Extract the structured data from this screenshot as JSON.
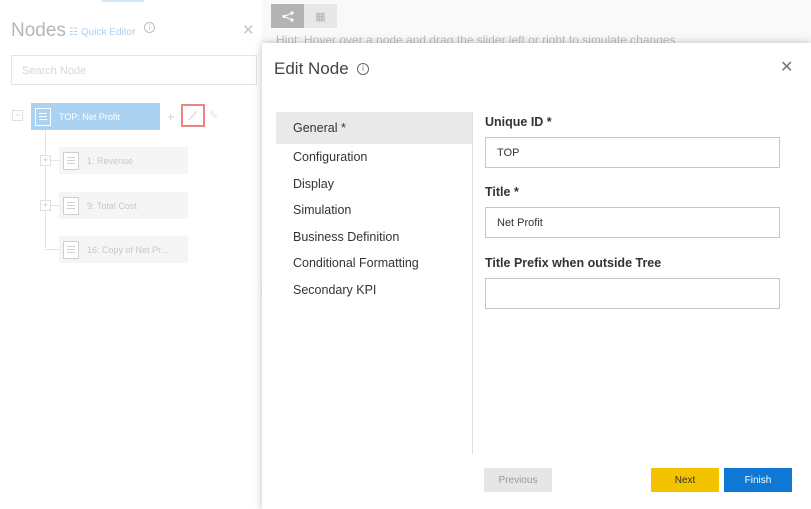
{
  "left_panel": {
    "title": "Nodes",
    "quick_editor": "Quick Editor",
    "search_placeholder": "Search Node",
    "nodes": [
      {
        "label": "TOP: Net Profit"
      },
      {
        "label": "1: Revenue"
      },
      {
        "label": "9: Total Cost"
      },
      {
        "label": "16: Copy of Net Pr..."
      }
    ]
  },
  "toolbar": {
    "hint": "Hint: Hover over a node and drag the slider left or right to simulate changes"
  },
  "modal": {
    "title": "Edit Node",
    "nav": [
      {
        "label": "General *"
      },
      {
        "label": "Configuration"
      },
      {
        "label": "Display"
      },
      {
        "label": "Simulation"
      },
      {
        "label": "Business Definition"
      },
      {
        "label": "Conditional Formatting"
      },
      {
        "label": "Secondary KPI"
      }
    ],
    "fields": {
      "unique_id_label": "Unique ID *",
      "unique_id_value": "TOP",
      "title_label": "Title *",
      "title_value": "Net Profit",
      "prefix_label": "Title Prefix when outside Tree",
      "prefix_value": ""
    },
    "buttons": {
      "previous": "Previous",
      "next": "Next",
      "finish": "Finish"
    }
  },
  "colors": {
    "accent_blue": "#0f78d4",
    "next_yellow": "#f3c300",
    "highlight_red": "#e02020",
    "node_blue": "#6aaee6"
  }
}
